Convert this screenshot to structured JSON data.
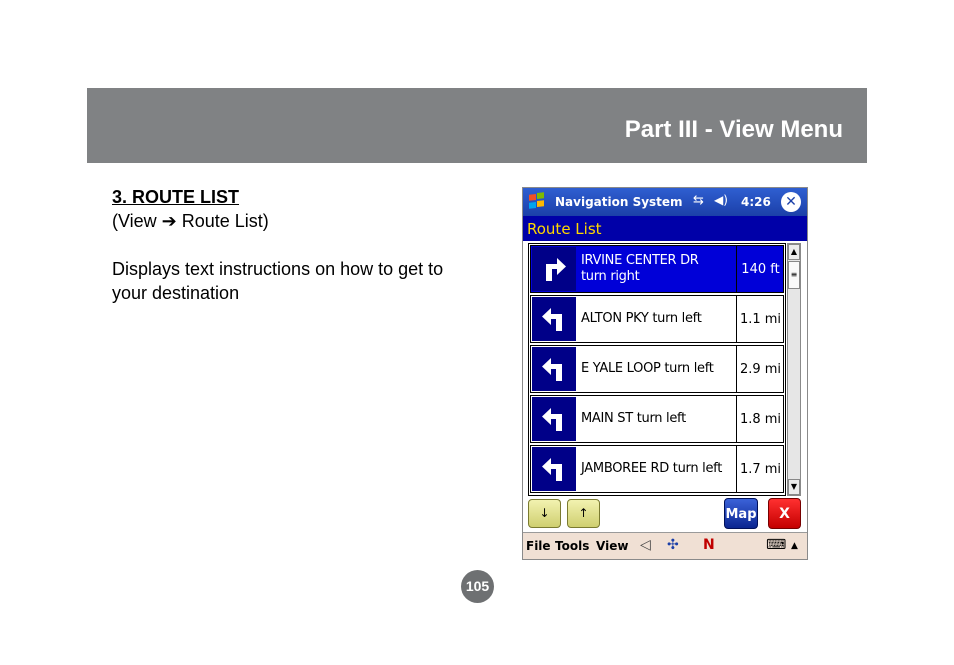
{
  "header": {
    "title": "Part III - View Menu"
  },
  "section": {
    "title": "3.  ROUTE LIST",
    "path": "(View ➔ Route List)",
    "description": "Displays text instructions on how to get to your destination"
  },
  "pda": {
    "app_title": "Navigation System",
    "time": "4:26",
    "close_label": "✕",
    "screen_title": "Route List",
    "rows": [
      {
        "street": "IRVINE CENTER DR\nturn right",
        "distance": "140 ft",
        "turn": "right",
        "selected": true
      },
      {
        "street": "ALTON PKY turn left",
        "distance": "1.1 mi",
        "turn": "left",
        "selected": false
      },
      {
        "street": "E YALE LOOP turn left",
        "distance": "2.9 mi",
        "turn": "left",
        "selected": false
      },
      {
        "street": "MAIN ST turn left",
        "distance": "1.8 mi",
        "turn": "left",
        "selected": false
      },
      {
        "street": "JAMBOREE RD turn left",
        "distance": "1.7 mi",
        "turn": "left",
        "selected": false
      }
    ],
    "buttons": {
      "down": "↓",
      "up": "↑",
      "map": "Map",
      "exit": "X"
    },
    "menu": [
      "File",
      "Tools",
      "View"
    ]
  },
  "page_number": "105"
}
